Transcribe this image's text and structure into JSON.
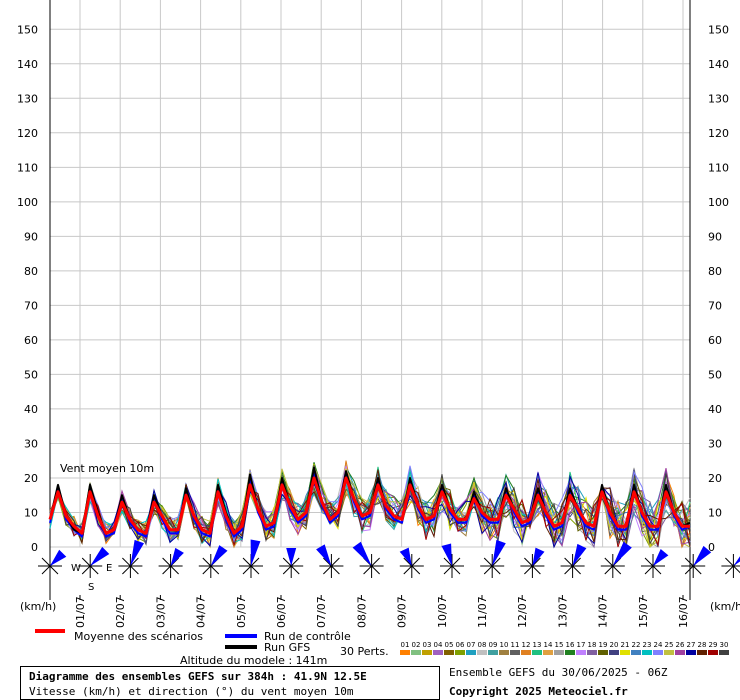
{
  "chart_data": {
    "type": "line",
    "ylim": [
      0,
      155
    ],
    "yticks": [
      0,
      10,
      20,
      30,
      40,
      50,
      60,
      70,
      80,
      90,
      100,
      110,
      120,
      130,
      140,
      150
    ],
    "x_unit_label": "(km/h)",
    "y_unit_label": "(km/h)",
    "date_labels": [
      "01/07",
      "02/07",
      "03/07",
      "04/07",
      "05/07",
      "06/07",
      "07/07",
      "08/07",
      "09/07",
      "10/07",
      "11/07",
      "12/07",
      "13/07",
      "14/07",
      "15/07",
      "16/07"
    ],
    "series_label": "Vent moyen 10m",
    "steps_per_day": 4,
    "mean_series": {
      "name": "Moyenne des scénarios",
      "color": "#ff0000",
      "values": [
        8,
        16,
        9,
        6,
        4,
        16,
        9,
        4,
        5,
        13,
        8,
        5,
        4,
        13,
        9,
        5,
        5,
        15,
        9,
        5,
        4,
        16,
        9,
        4,
        6,
        18,
        11,
        6,
        7,
        18,
        12,
        8,
        10,
        20,
        13,
        8,
        10,
        20,
        14,
        9,
        10,
        18,
        12,
        9,
        8,
        18,
        12,
        8,
        9,
        16,
        11,
        8,
        8,
        14,
        10,
        8,
        8,
        15,
        11,
        7,
        8,
        15,
        10,
        6,
        7,
        15,
        11,
        7,
        6,
        16,
        10,
        6,
        6,
        16,
        10,
        6,
        6,
        16,
        10,
        6,
        6
      ]
    },
    "control_series": {
      "name": "Run de contrôle",
      "color": "#0000ff",
      "values": [
        7,
        17,
        8,
        5,
        3,
        17,
        9,
        3,
        4,
        14,
        7,
        4,
        3,
        14,
        8,
        4,
        4,
        16,
        8,
        4,
        3,
        17,
        8,
        3,
        5,
        20,
        10,
        5,
        6,
        19,
        11,
        7,
        9,
        22,
        12,
        7,
        9,
        21,
        13,
        8,
        9,
        19,
        11,
        8,
        7,
        19,
        11,
        7,
        8,
        17,
        10,
        7,
        7,
        15,
        9,
        7,
        7,
        16,
        10,
        6,
        7,
        16,
        9,
        5,
        6,
        16,
        10,
        6,
        5,
        17,
        9,
        5,
        5,
        17,
        9,
        5,
        5,
        17,
        9,
        5,
        6
      ]
    },
    "gfs_series": {
      "name": "Run GFS",
      "color": "#000000",
      "values": [
        8,
        18,
        9,
        5,
        4,
        18,
        10,
        4,
        5,
        15,
        8,
        5,
        4,
        15,
        9,
        5,
        5,
        17,
        9,
        5,
        4,
        18,
        10,
        4,
        6,
        21,
        11,
        6,
        7,
        20,
        12,
        8,
        10,
        23,
        13,
        8,
        10,
        22,
        14,
        9,
        10,
        20,
        12,
        9,
        8,
        20,
        12,
        8,
        9,
        18,
        11,
        8,
        8,
        16,
        10,
        8,
        8,
        17,
        11,
        7,
        8,
        17,
        10,
        6,
        7,
        17,
        11,
        7,
        6,
        18,
        10,
        6,
        6,
        18,
        10,
        6,
        6,
        18,
        10,
        6,
        7
      ]
    },
    "perturbations_label": "30 Perts.",
    "perturbation_numbers": [
      "01",
      "02",
      "03",
      "04",
      "05",
      "06",
      "07",
      "08",
      "09",
      "10",
      "11",
      "12",
      "13",
      "14",
      "15",
      "16",
      "17",
      "18",
      "19",
      "20",
      "21",
      "22",
      "23",
      "24",
      "25",
      "26",
      "27",
      "28",
      "29",
      "30"
    ],
    "perturbation_colors": [
      "#ff8000",
      "#80c080",
      "#c0a000",
      "#a060c0",
      "#806000",
      "#80a000",
      "#20a0c0",
      "#c0c0c0",
      "#40a0a0",
      "#a08040",
      "#606060",
      "#e08020",
      "#20c080",
      "#e0a040",
      "#a0a0a0",
      "#208020",
      "#c080ff",
      "#8060a0",
      "#606000",
      "#404080",
      "#e0e000",
      "#4080c0",
      "#00c0c0",
      "#8080ff",
      "#c0c040",
      "#a040a0",
      "#0000a0",
      "#602000",
      "#a00000",
      "#404040"
    ],
    "wind_directions_deg": [
      225,
      225,
      200,
      210,
      215,
      190,
      180,
      150,
      145,
      155,
      165,
      200,
      205,
      205,
      215,
      220,
      220,
      225
    ]
  },
  "legend": {
    "mean_label": "Moyenne des scénarios",
    "control_label": "Run de contrôle",
    "gfs_label": "Run GFS",
    "altitude": "Altitude du modele : 141m",
    "compass": {
      "w": "W",
      "e": "E",
      "s": "S"
    }
  },
  "footer": {
    "title": "Diagramme des ensembles GEFS sur 384h : 41.9N 12.5E",
    "subtitle": "Vitesse (km/h) et direction (°) du vent moyen 10m",
    "run_info": "Ensemble GEFS du 30/06/2025 - 06Z",
    "copyright": "Copyright 2025 Meteociel.fr"
  },
  "colors": {
    "grid": "#c8c8c8",
    "mean": "#ff0000",
    "control": "#0000ff",
    "gfs": "#000000",
    "wind_arrow": "#0000ff"
  }
}
